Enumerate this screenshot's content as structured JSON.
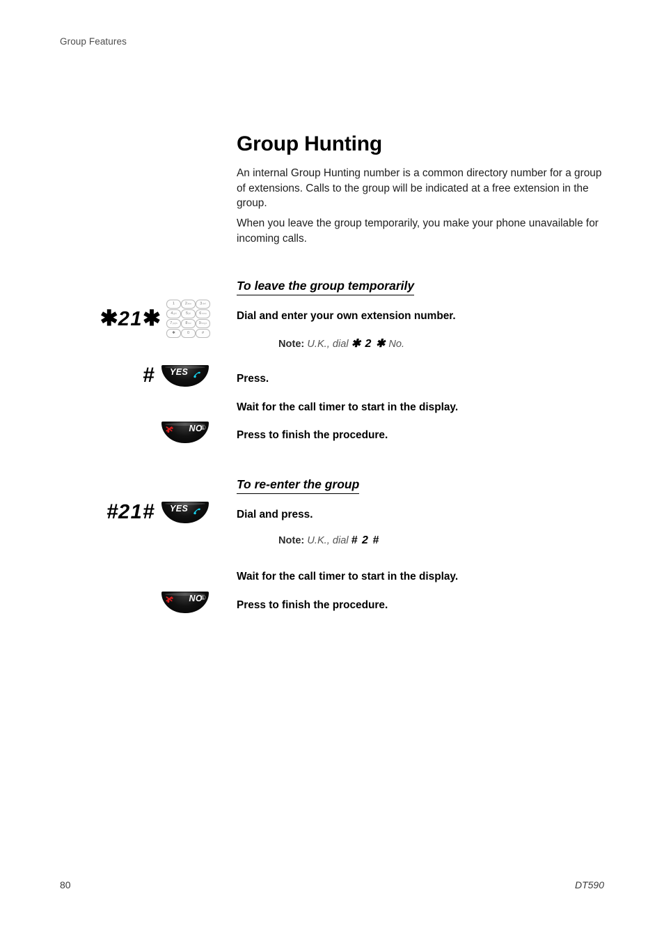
{
  "header": {
    "running_head": "Group Features"
  },
  "chapter": {
    "title": "Group Hunting",
    "intro_paragraphs": [
      "An internal Group Hunting number is a common directory number for a group of extensions. Calls to the group will be indicated at a free extension in the group.",
      "When you leave the group temporarily, you make your phone unavailable for incoming calls."
    ]
  },
  "sections": [
    {
      "heading": "To leave the group temporarily",
      "steps": [
        {
          "dialcode": "✱21✱",
          "dialcode_parts": [
            "✱",
            "2",
            "1",
            "✱"
          ],
          "icon": "keypad-icon",
          "text": "Dial and enter your own extension number."
        },
        {
          "note_label": "Note:",
          "note_text_pre": "U.K., dial",
          "note_code": "✱ 2 ✱",
          "note_text_post": "No."
        },
        {
          "dialcode": "#",
          "icon": "yes-button-icon",
          "button_label": "YES",
          "text": "Press."
        },
        {
          "text": "Wait for the call timer to start in the display."
        },
        {
          "icon": "no-button-icon",
          "button_label": "NO",
          "button_badge": "①",
          "text": "Press to finish the procedure."
        }
      ]
    },
    {
      "heading": "To re-enter the group",
      "steps": [
        {
          "dialcode": "#21#",
          "dialcode_parts": [
            "#",
            "2",
            "1",
            "#"
          ],
          "icon": "yes-button-icon",
          "button_label": "YES",
          "text": "Dial and press."
        },
        {
          "note_label": "Note:",
          "note_text_pre": "U.K., dial",
          "note_code": "# 2 #",
          "note_text_post": ""
        },
        {
          "text": "Wait for the call timer to start in the display."
        },
        {
          "icon": "no-button-icon",
          "button_label": "NO",
          "button_badge": "①",
          "text": "Press to finish the procedure."
        }
      ]
    }
  ],
  "keypad": {
    "keys": [
      {
        "digit": "1",
        "letters": ""
      },
      {
        "digit": "2",
        "letters": "abc"
      },
      {
        "digit": "3",
        "letters": "def"
      },
      {
        "digit": "4",
        "letters": "ghi"
      },
      {
        "digit": "5",
        "letters": "jkl"
      },
      {
        "digit": "6",
        "letters": "mno"
      },
      {
        "digit": "7",
        "letters": "pqrs"
      },
      {
        "digit": "8",
        "letters": "tuv"
      },
      {
        "digit": "9",
        "letters": "wxyz"
      },
      {
        "digit": "✱",
        "letters": ""
      },
      {
        "digit": "0",
        "letters": ""
      },
      {
        "digit": "#",
        "letters": ""
      }
    ]
  },
  "footer": {
    "page_number": "80",
    "model": "DT590"
  },
  "colors": {
    "handset_cyan": "#17d4ef",
    "cross_red": "#d81f1f",
    "button_black": "#000000",
    "text_black": "#000000",
    "note_gray": "#555555"
  }
}
